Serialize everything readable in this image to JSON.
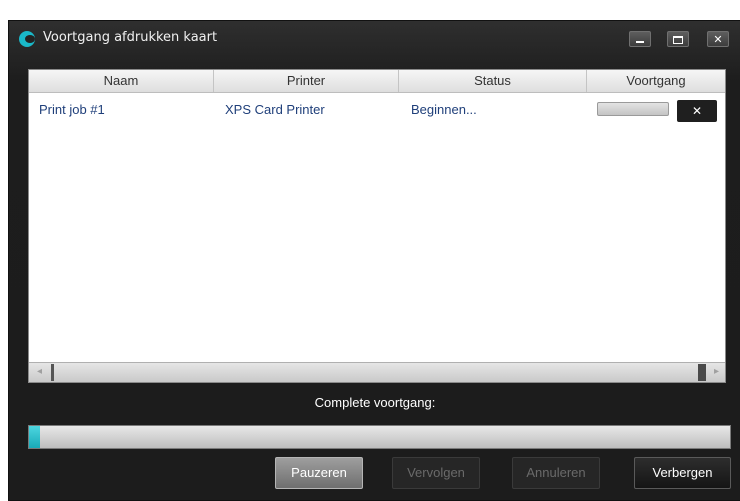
{
  "window": {
    "title": "Voortgang afdrukken kaart",
    "controls": {
      "minimize": "minimize-icon",
      "maximize": "maximize-icon",
      "close": "✕"
    }
  },
  "table": {
    "columns": [
      "Naam",
      "Printer",
      "Status",
      "Voortgang"
    ],
    "rows": [
      {
        "name": "Print job #1",
        "printer": "XPS Card Printer",
        "status": "Beginnen...",
        "progress": 0.0,
        "cancel": "✕"
      }
    ],
    "scrollbar": {
      "left_arrow": "◂",
      "right_arrow": "▸"
    }
  },
  "overall": {
    "label": "Complete voortgang:",
    "progress": 0.01
  },
  "buttons": {
    "pause": "Pauzeren",
    "resume": "Vervolgen",
    "cancel": "Annuleren",
    "hide": "Verbergen"
  },
  "colors": {
    "accent": "#1ab8c8",
    "cell_text": "#1f3f7a"
  }
}
